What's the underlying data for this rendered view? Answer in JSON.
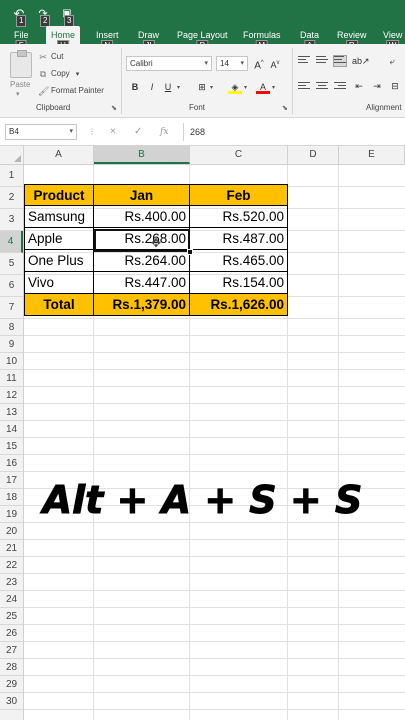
{
  "quick_access": [
    {
      "icon": "undo-icon",
      "glyph": "↶",
      "keytip": "1"
    },
    {
      "icon": "redo-icon",
      "glyph": "↷",
      "keytip": "2"
    },
    {
      "icon": "save-icon",
      "glyph": "▬",
      "keytip": "3"
    }
  ],
  "tabs": [
    {
      "label": "File",
      "keytip": "F"
    },
    {
      "label": "Home",
      "keytip": "H",
      "active": true
    },
    {
      "label": "Insert",
      "keytip": "N"
    },
    {
      "label": "Draw",
      "keytip": "JI"
    },
    {
      "label": "Page Layout",
      "keytip": "P"
    },
    {
      "label": "Formulas",
      "keytip": "M"
    },
    {
      "label": "Data",
      "keytip": "A"
    },
    {
      "label": "Review",
      "keytip": "R"
    },
    {
      "label": "View",
      "keytip": "W"
    }
  ],
  "ribbon": {
    "clipboard": {
      "paste_label": "Paste",
      "cut_label": "Cut",
      "copy_label": "Copy",
      "format_painter_label": "Format Painter",
      "group_label": "Clipboard"
    },
    "font": {
      "font_name": "Calibri",
      "font_size": "14",
      "bold": "B",
      "italic": "I",
      "underline": "U",
      "group_label": "Font"
    },
    "alignment": {
      "group_label": "Alignment"
    }
  },
  "formula_bar": {
    "name_box": "B4",
    "cancel_icon": "×",
    "enter_icon": "✓",
    "fx_label": "fx",
    "value": "268"
  },
  "columns": [
    "A",
    "B",
    "C",
    "D",
    "E"
  ],
  "selected_column": "B",
  "rows": [
    "1",
    "2",
    "3",
    "4",
    "5",
    "6",
    "7",
    "8",
    "9",
    "10",
    "11",
    "12",
    "13",
    "14",
    "15",
    "16",
    "17",
    "18",
    "19",
    "20",
    "21",
    "22",
    "23",
    "24",
    "25",
    "26",
    "27",
    "28",
    "29",
    "30"
  ],
  "selected_row": "4",
  "table": {
    "headers": [
      "Product",
      "Jan",
      "Feb"
    ],
    "rows": [
      [
        "Samsung",
        "Rs.400.00",
        "Rs.520.00"
      ],
      [
        "Apple",
        "Rs.268.00",
        "Rs.487.00"
      ],
      [
        "One Plus",
        "Rs.264.00",
        "Rs.465.00"
      ],
      [
        "Vivo",
        "Rs.447.00",
        "Rs.154.00"
      ]
    ],
    "total": [
      "Total",
      "Rs.1,379.00",
      "Rs.1,626.00"
    ]
  },
  "colors": {
    "ribbon_green": "#217346",
    "header_fill": "#ffc000"
  },
  "overlay_text": "Alt + A + S + S"
}
